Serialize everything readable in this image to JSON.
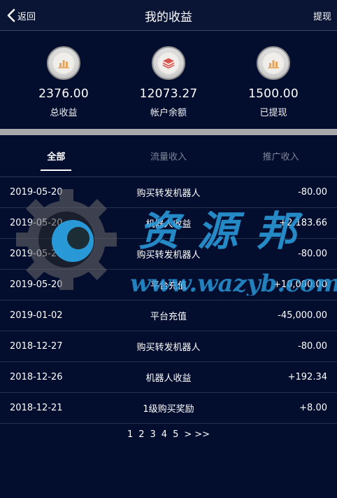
{
  "header": {
    "back_label": "返回",
    "title": "我的收益",
    "withdraw_label": "提现"
  },
  "stats": [
    {
      "value": "2376.00",
      "label": "总收益",
      "icon": "bar-chart-icon"
    },
    {
      "value": "12073.27",
      "label": "帐户余额",
      "icon": "layers-icon"
    },
    {
      "value": "1500.00",
      "label": "已提现",
      "icon": "bar-chart-icon"
    }
  ],
  "tabs": [
    {
      "label": "全部",
      "active": true
    },
    {
      "label": "流量收入",
      "active": false
    },
    {
      "label": "推广收入",
      "active": false
    }
  ],
  "records": [
    {
      "date": "2019-05-20",
      "desc": "购买转发机器人",
      "amount": "-80.00"
    },
    {
      "date": "2019-05-20",
      "desc": "机器人收益",
      "amount": "+2,183.66"
    },
    {
      "date": "2019-05-20",
      "desc": "购买转发机器人",
      "amount": "-80.00"
    },
    {
      "date": "2019-05-20",
      "desc": "平台充值",
      "amount": "+10,000.00"
    },
    {
      "date": "2019-01-02",
      "desc": "平台充值",
      "amount": "-45,000.00"
    },
    {
      "date": "2018-12-27",
      "desc": "购买转发机器人",
      "amount": "-80.00"
    },
    {
      "date": "2018-12-26",
      "desc": "机器人收益",
      "amount": "+192.34"
    },
    {
      "date": "2018-12-21",
      "desc": "1级购买奖励",
      "amount": "+8.00"
    }
  ],
  "pagination": {
    "pages": [
      "1",
      "2",
      "3",
      "4",
      "5"
    ],
    "next": ">",
    "last": ">>"
  },
  "watermark": {
    "text": "资源邦",
    "url": "www.wazyb.com"
  },
  "colors": {
    "background": "#030d2e",
    "header_bg": "#0a1434",
    "divider": "#a7a9ab",
    "icon_orange": "#e8a35a",
    "icon_red": "#d9534f",
    "watermark_blue": "#2a9fe0"
  }
}
